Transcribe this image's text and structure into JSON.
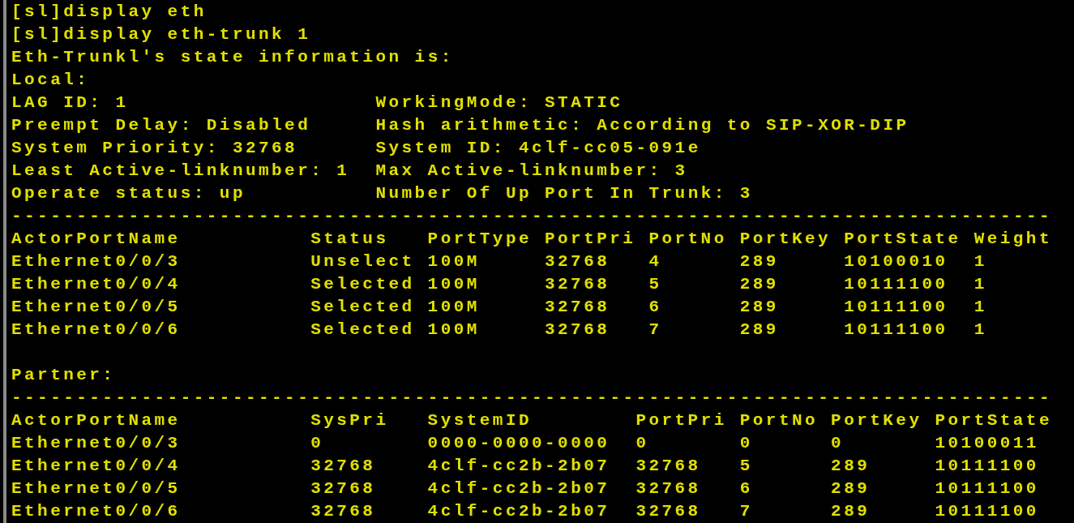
{
  "terminal": {
    "lines": [
      "[sl]display eth",
      "[sl]display eth-trunk 1",
      "Eth-Trunkl's state information is:",
      "Local:"
    ],
    "local_fields": [
      {
        "left": "LAG ID: 1",
        "right": "WorkingMode: STATIC"
      },
      {
        "left": "Preempt Delay: Disabled",
        "right": "Hash arithmetic: According to SIP-XOR-DIP"
      },
      {
        "left": "System Priority: 32768",
        "right": "System ID: 4clf-cc05-091e"
      },
      {
        "left": "Least Active-linknumber: 1",
        "right": "Max Active-linknumber: 3"
      },
      {
        "left": "Operate status: up",
        "right": "Number Of Up Port In Trunk: 3"
      }
    ],
    "local_table": {
      "rule": "--------------------------------------------------------------------------------",
      "columns": [
        "ActorPortName",
        "Status",
        "PortType",
        "PortPri",
        "PortNo",
        "PortKey",
        "PortState",
        "Weight"
      ],
      "rows": [
        [
          "Ethernet0/0/3",
          "Unselect",
          "100M",
          "32768",
          "4",
          "289",
          "10100010",
          "1"
        ],
        [
          "Ethernet0/0/4",
          "Selected",
          "100M",
          "32768",
          "5",
          "289",
          "10111100",
          "1"
        ],
        [
          "Ethernet0/0/5",
          "Selected",
          "100M",
          "32768",
          "6",
          "289",
          "10111100",
          "1"
        ],
        [
          "Ethernet0/0/6",
          "Selected",
          "100M",
          "32768",
          "7",
          "289",
          "10111100",
          "1"
        ]
      ]
    },
    "partner_label": "Partner:",
    "partner_table": {
      "rule": "--------------------------------------------------------------------------------",
      "columns": [
        "ActorPortName",
        "SysPri",
        "SystemID",
        "PortPri",
        "PortNo",
        "PortKey",
        "PortState"
      ],
      "rows": [
        [
          "Ethernet0/0/3",
          "0",
          "0000-0000-0000",
          "0",
          "0",
          "0",
          "10100011"
        ],
        [
          "Ethernet0/0/4",
          "32768",
          "4clf-cc2b-2b07",
          "32768",
          "5",
          "289",
          "10111100"
        ],
        [
          "Ethernet0/0/5",
          "32768",
          "4clf-cc2b-2b07",
          "32768",
          "6",
          "289",
          "10111100"
        ],
        [
          "Ethernet0/0/6",
          "32768",
          "4clf-cc2b-2b07",
          "32768",
          "7",
          "289",
          "10111100"
        ]
      ]
    }
  }
}
